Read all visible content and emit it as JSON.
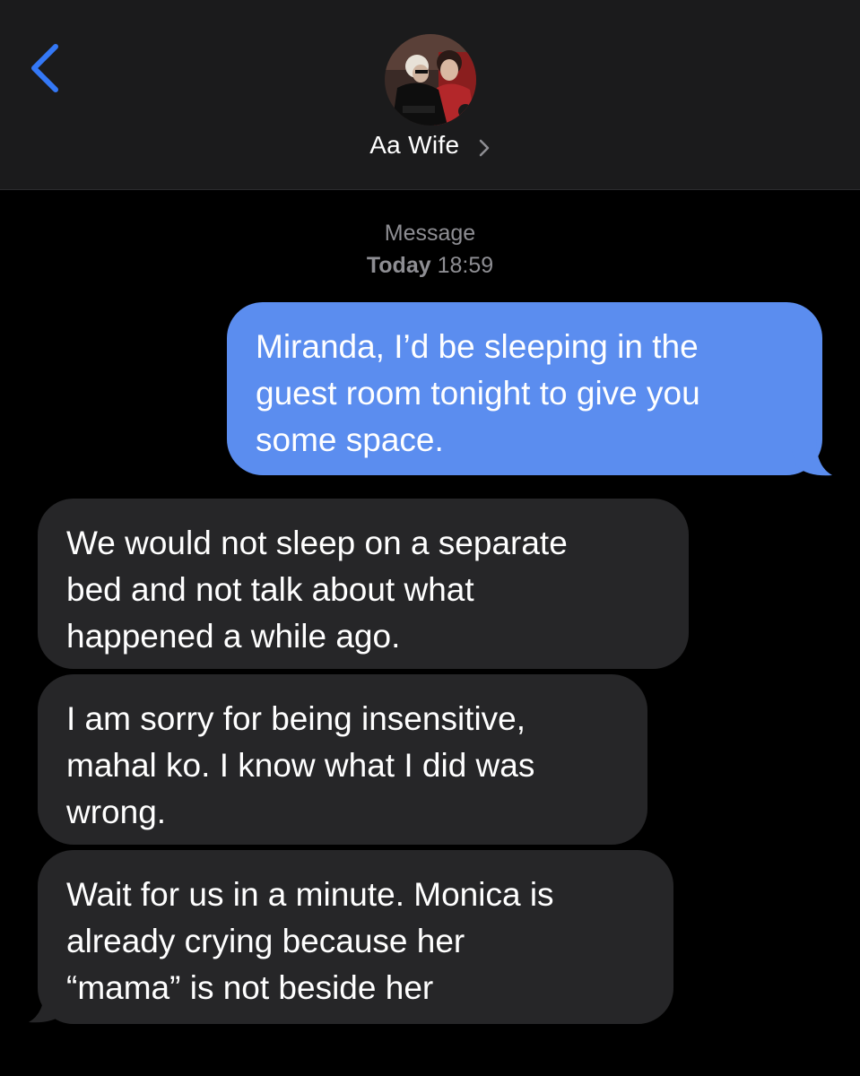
{
  "header": {
    "back_icon": "chevron-left-icon",
    "avatar_icon": "contact-photo",
    "contact_name": "Aa Wife",
    "contact_chevron_icon": "chevron-right-icon"
  },
  "thread": {
    "service": "Message",
    "day": "Today",
    "time": "18:59"
  },
  "messages": [
    {
      "direction": "sent",
      "lines": [
        "Miranda, I’d be sleeping in the",
        "guest room tonight to give you",
        "some space."
      ]
    },
    {
      "direction": "received",
      "lines": [
        "We would not sleep on a separate",
        "bed and not talk about what",
        "happened a while ago."
      ]
    },
    {
      "direction": "received",
      "lines": [
        "I am sorry for being insensitive,",
        "mahal ko. I know what I did was",
        "wrong."
      ]
    },
    {
      "direction": "received",
      "lines": [
        "Wait for us in a minute. Monica is",
        "already crying because her",
        "“mama” is not beside her"
      ]
    }
  ],
  "colors": {
    "background": "#000000",
    "header_bg": "#1b1b1c",
    "sent_bubble": "#5b8def",
    "received_bubble": "#262628",
    "accent_blue": "#3478f6",
    "meta_text": "#8e8e93"
  }
}
